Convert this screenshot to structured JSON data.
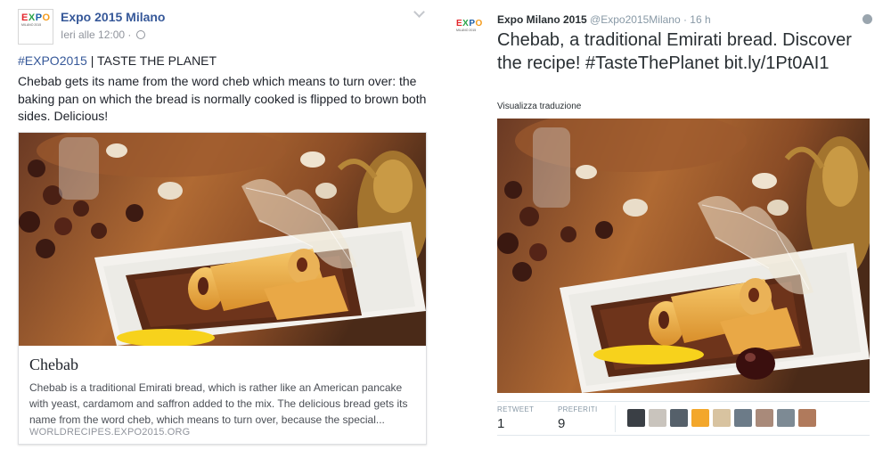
{
  "facebook": {
    "page_name": "Expo 2015 Milano",
    "timestamp": "Ieri alle 12:00 ·",
    "hashtag": "#EXPO2015",
    "hashtag_suffix": " | TASTE THE PLANET",
    "post_text": "Chebab gets its name from the word cheb which means to turn over: the baking pan on which the bread is normally cooked is flipped to brown both sides. Delicious!",
    "card": {
      "title": "Chebab",
      "description": "Chebab is a traditional Emirati bread, which is rather like an American pancake with yeast, cardamom and saffron added to the mix. The delicious bread gets its name from the word cheb, which means to turn over, because the special...",
      "domain": "WORLDRECIPES.EXPO2015.ORG"
    }
  },
  "twitter": {
    "display_name": "Expo Milano 2015",
    "handle_time": "@Expo2015Milano · 16 h",
    "tweet_text": "Chebab, a traditional Emirati bread. Discover the recipe! #TasteThePlanet bit.ly/1Pt0AI1",
    "translate_link": "Visualizza traduzione",
    "stats": [
      {
        "label": "RETWEET",
        "value": "1"
      },
      {
        "label": "PREFERITI",
        "value": "9"
      }
    ],
    "avatar_colors": [
      "#3a3f45",
      "#c9c4bd",
      "#55606a",
      "#f3a72b",
      "#d8c3a0",
      "#6c7b88",
      "#a98a7a",
      "#7d8a94",
      "#b07a5c"
    ]
  },
  "logo": {
    "letters": [
      "E",
      "X",
      "P",
      "O"
    ],
    "subtitle": "MILANO 2015"
  },
  "colors": {
    "fb_link": "#365899",
    "tw_text": "#292f33",
    "tw_muted": "#8899a6"
  }
}
